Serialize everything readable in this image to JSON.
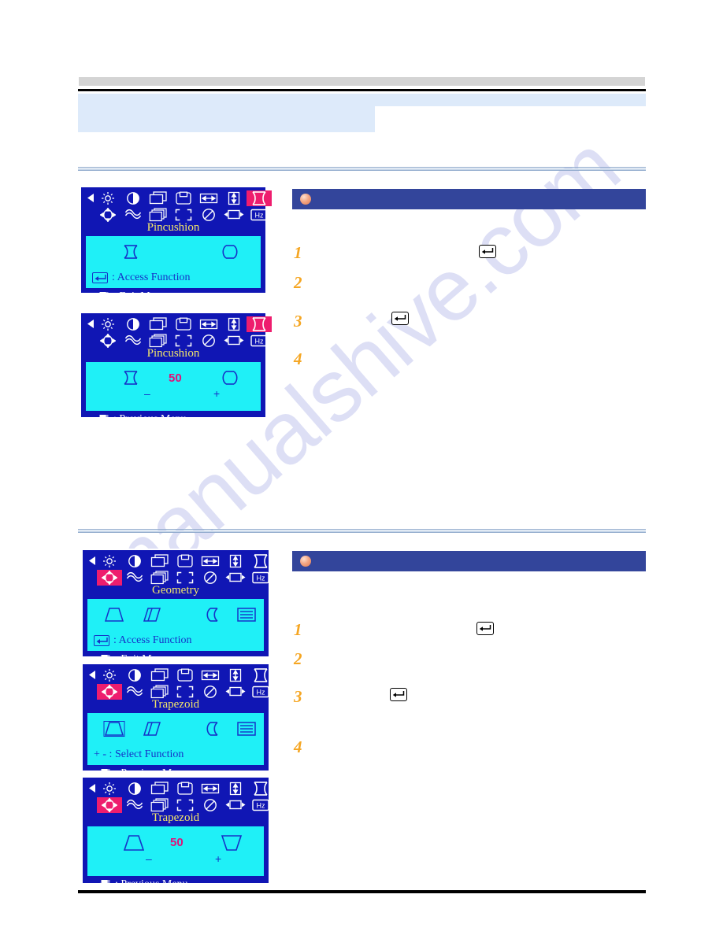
{
  "page": {
    "title": "",
    "watermark": "manualshive.com"
  },
  "colors": {
    "osd_background": "#1016b4",
    "osd_panel": "#1ff0f7",
    "osd_selected": "#ee1d6e",
    "osd_title_text": "#f2e56a",
    "osd_value_text": "#e0127a",
    "section_header": "#33459b",
    "step_number": "#f5a623",
    "header_block": "#ddeafa",
    "header_gray": "#d4d4d4"
  },
  "osd_icon_names": {
    "row1": [
      "left-arrow-icon",
      "brightness-icon",
      "contrast-icon",
      "h-position-icon",
      "v-position-icon",
      "h-size-icon",
      "v-size-icon",
      "pincushion-icon"
    ],
    "row2": [
      "geometry-icon",
      "pinbalance-icon",
      "parallelogram-icon",
      "zoom-icon",
      "degauss-icon",
      "osd-position-icon",
      "recall-hz-icon",
      "right-arrow-icon"
    ]
  },
  "sections": [
    {
      "id": "pincushion",
      "header": {
        "title": ""
      },
      "steps": [
        {
          "num": "1",
          "text": "",
          "has_enter_key": true
        },
        {
          "num": "2",
          "text": "",
          "has_enter_key": false
        },
        {
          "num": "3",
          "text": "",
          "has_enter_key": true
        },
        {
          "num": "4",
          "text": "",
          "has_enter_key": false
        }
      ],
      "osd_panels": [
        {
          "id": "pincushion-menu",
          "title": "Pincushion",
          "selected_icon": "pincushion-icon",
          "functions": [
            "pincushion-in-icon",
            "pincushion-out-icon"
          ],
          "hint": ": Access Function",
          "hint_key": "enter-key-icon",
          "footer": ": Exit Menu",
          "footer_key": "exit-menu-icon",
          "value": null
        },
        {
          "id": "pincushion-adjust",
          "title": "Pincushion",
          "selected_icon": "pincushion-icon",
          "functions": [
            "pincushion-in-icon",
            "pincushion-out-icon"
          ],
          "hint": null,
          "footer": ": Previous Menu",
          "footer_key": "exit-menu-icon",
          "value": "50",
          "minus": "–",
          "plus": "+"
        }
      ]
    },
    {
      "id": "trapezoid",
      "header": {
        "title": ""
      },
      "steps": [
        {
          "num": "1",
          "text": "",
          "has_enter_key": true
        },
        {
          "num": "2",
          "text": "",
          "has_enter_key": false
        },
        {
          "num": "3",
          "text": "",
          "has_enter_key": true
        },
        {
          "num": "4",
          "text": "",
          "has_enter_key": false
        }
      ],
      "osd_panels": [
        {
          "id": "geometry-menu",
          "title": "Geometry",
          "selected_icon": "geometry-icon",
          "functions": [
            "trapezoid-icon",
            "parallelogram-icon",
            "pin-balance-icon",
            "linearity-icon"
          ],
          "hint": ": Access Function",
          "hint_key": "enter-key-icon",
          "footer": ": Exit Menu",
          "footer_key": "exit-menu-icon",
          "value": null
        },
        {
          "id": "trapezoid-select",
          "title": "Trapezoid",
          "selected_icon": "geometry-icon",
          "functions": [
            "trapezoid-icon",
            "parallelogram-icon",
            "pin-balance-icon",
            "linearity-icon"
          ],
          "hint": "+ - : Select Function",
          "hint_key": null,
          "footer": ": Previous Menu",
          "footer_key": "exit-menu-icon",
          "value": null
        },
        {
          "id": "trapezoid-adjust",
          "title": "Trapezoid",
          "selected_icon": "geometry-icon",
          "functions": [
            "trapezoid-narrow-top-icon",
            "trapezoid-narrow-bottom-icon"
          ],
          "hint": null,
          "footer": ": Previous Menu",
          "footer_key": "exit-menu-icon",
          "value": "50",
          "minus": "–",
          "plus": "+"
        }
      ]
    }
  ]
}
